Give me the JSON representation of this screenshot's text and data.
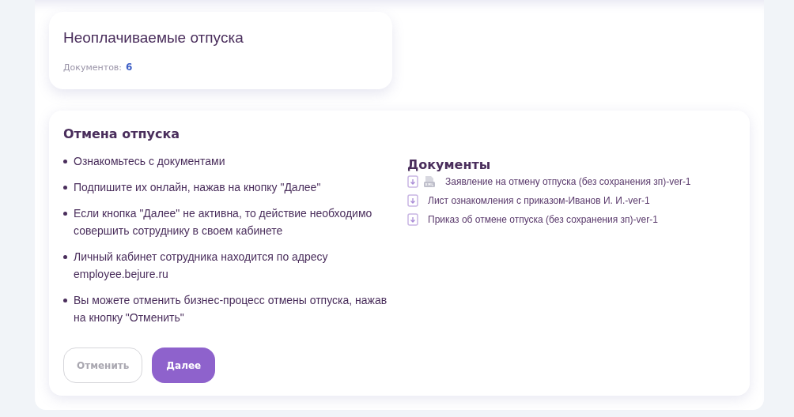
{
  "category_card": {
    "title": "Неоплачиваемые отпуска",
    "count_label": "Документов:",
    "count": "6"
  },
  "process": {
    "title": "Отмена отпуска",
    "steps": [
      "Ознакомьтесь с документами",
      "Подпишите их онлайн, нажав на кнопку \"Далее\"",
      "Если кнопка \"Далее\" не активна, то действие необходимо совершить сотруднику в своем кабинете",
      "Личный кабинет сотрудника находится по адресу employee.bejure.ru",
      "Вы можете отменить бизнес-процесс отмены отпуска, нажав на кнопку \"Отменить\""
    ],
    "documents_title": "Документы",
    "documents": [
      {
        "name": "Заявление на отмену отпуска (без сохранения зп)-ver-1",
        "kind": "with-xml"
      },
      {
        "name": "Лист ознакомления с приказом-Иванов И. И.-ver-1",
        "kind": "plain"
      },
      {
        "name": "Приказ об отмене отпуска (без сохранения зп)-ver-1",
        "kind": "plain"
      }
    ],
    "buttons": [
      {
        "label": "Отменить",
        "kind": "outline",
        "disabled": true
      },
      {
        "label": "Далее",
        "kind": "primary",
        "disabled": false
      }
    ]
  }
}
